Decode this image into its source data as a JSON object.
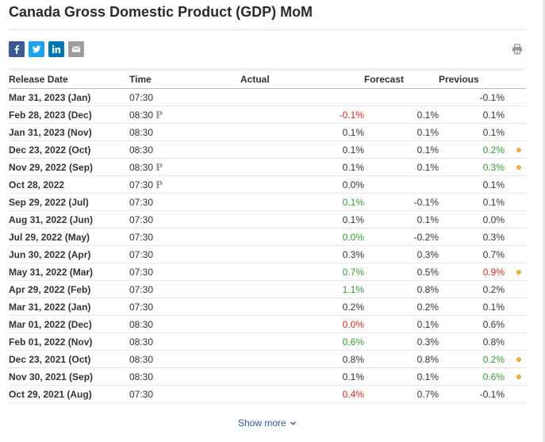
{
  "title": "Canada Gross Domestic Product (GDP) MoM",
  "share": {
    "facebook_icon": "facebook-icon",
    "twitter_icon": "twitter-icon",
    "linkedin_icon": "linkedin-icon",
    "email_icon": "email-icon",
    "print_icon": "print-icon"
  },
  "colors": {
    "positive": "#2ca02c",
    "negative": "#e0241d",
    "neutral": "#333333",
    "revision_dot": "#f0ad2f",
    "link": "#1f5d9c"
  },
  "table": {
    "headers": {
      "release_date": "Release Date",
      "time": "Time",
      "actual": "Actual",
      "forecast": "Forecast",
      "previous": "Previous"
    },
    "preliminary_mark": "P",
    "rows": [
      {
        "date": "Mar 31, 2023 (Jan)",
        "time": "07:30",
        "prelim": false,
        "actual": "",
        "actual_color": "neutral",
        "forecast": "",
        "previous": "-0.1%",
        "previous_color": "neutral",
        "revised": false
      },
      {
        "date": "Feb 28, 2023 (Dec)",
        "time": "08:30",
        "prelim": true,
        "actual": "-0.1%",
        "actual_color": "negative",
        "forecast": "0.1%",
        "previous": "0.1%",
        "previous_color": "neutral",
        "revised": false
      },
      {
        "date": "Jan 31, 2023 (Nov)",
        "time": "08:30",
        "prelim": false,
        "actual": "0.1%",
        "actual_color": "neutral",
        "forecast": "0.1%",
        "previous": "0.1%",
        "previous_color": "neutral",
        "revised": false
      },
      {
        "date": "Dec 23, 2022 (Oct)",
        "time": "08:30",
        "prelim": false,
        "actual": "0.1%",
        "actual_color": "neutral",
        "forecast": "0.1%",
        "previous": "0.2%",
        "previous_color": "positive",
        "revised": true
      },
      {
        "date": "Nov 29, 2022 (Sep)",
        "time": "08:30",
        "prelim": true,
        "actual": "0.1%",
        "actual_color": "neutral",
        "forecast": "0.1%",
        "previous": "0.3%",
        "previous_color": "positive",
        "revised": true
      },
      {
        "date": "Oct 28, 2022",
        "time": "07:30",
        "prelim": true,
        "actual": "0.0%",
        "actual_color": "neutral",
        "forecast": "",
        "previous": "0.1%",
        "previous_color": "neutral",
        "revised": false
      },
      {
        "date": "Sep 29, 2022 (Jul)",
        "time": "07:30",
        "prelim": false,
        "actual": "0.1%",
        "actual_color": "positive",
        "forecast": "-0.1%",
        "previous": "0.1%",
        "previous_color": "neutral",
        "revised": false
      },
      {
        "date": "Aug 31, 2022 (Jun)",
        "time": "07:30",
        "prelim": false,
        "actual": "0.1%",
        "actual_color": "neutral",
        "forecast": "0.1%",
        "previous": "0.0%",
        "previous_color": "neutral",
        "revised": false
      },
      {
        "date": "Jul 29, 2022 (May)",
        "time": "07:30",
        "prelim": false,
        "actual": "0.0%",
        "actual_color": "positive",
        "forecast": "-0.2%",
        "previous": "0.3%",
        "previous_color": "neutral",
        "revised": false
      },
      {
        "date": "Jun 30, 2022 (Apr)",
        "time": "07:30",
        "prelim": false,
        "actual": "0.3%",
        "actual_color": "neutral",
        "forecast": "0.3%",
        "previous": "0.7%",
        "previous_color": "neutral",
        "revised": false
      },
      {
        "date": "May 31, 2022 (Mar)",
        "time": "07:30",
        "prelim": false,
        "actual": "0.7%",
        "actual_color": "positive",
        "forecast": "0.5%",
        "previous": "0.9%",
        "previous_color": "negative",
        "revised": true
      },
      {
        "date": "Apr 29, 2022 (Feb)",
        "time": "07:30",
        "prelim": false,
        "actual": "1.1%",
        "actual_color": "positive",
        "forecast": "0.8%",
        "previous": "0.2%",
        "previous_color": "neutral",
        "revised": false
      },
      {
        "date": "Mar 31, 2022 (Jan)",
        "time": "07:30",
        "prelim": false,
        "actual": "0.2%",
        "actual_color": "neutral",
        "forecast": "0.2%",
        "previous": "0.1%",
        "previous_color": "neutral",
        "revised": false
      },
      {
        "date": "Mar 01, 2022 (Dec)",
        "time": "08:30",
        "prelim": false,
        "actual": "0.0%",
        "actual_color": "negative",
        "forecast": "0.1%",
        "previous": "0.6%",
        "previous_color": "neutral",
        "revised": false
      },
      {
        "date": "Feb 01, 2022 (Nov)",
        "time": "08:30",
        "prelim": false,
        "actual": "0.6%",
        "actual_color": "positive",
        "forecast": "0.3%",
        "previous": "0.8%",
        "previous_color": "neutral",
        "revised": false
      },
      {
        "date": "Dec 23, 2021 (Oct)",
        "time": "08:30",
        "prelim": false,
        "actual": "0.8%",
        "actual_color": "neutral",
        "forecast": "0.8%",
        "previous": "0.2%",
        "previous_color": "positive",
        "revised": true
      },
      {
        "date": "Nov 30, 2021 (Sep)",
        "time": "08:30",
        "prelim": false,
        "actual": "0.1%",
        "actual_color": "neutral",
        "forecast": "0.1%",
        "previous": "0.6%",
        "previous_color": "positive",
        "revised": true
      },
      {
        "date": "Oct 29, 2021 (Aug)",
        "time": "07:30",
        "prelim": false,
        "actual": "0.4%",
        "actual_color": "negative",
        "forecast": "0.7%",
        "previous": "-0.1%",
        "previous_color": "neutral",
        "revised": false
      }
    ]
  },
  "show_more": {
    "label": "Show more",
    "icon": "chevron-down-icon"
  }
}
